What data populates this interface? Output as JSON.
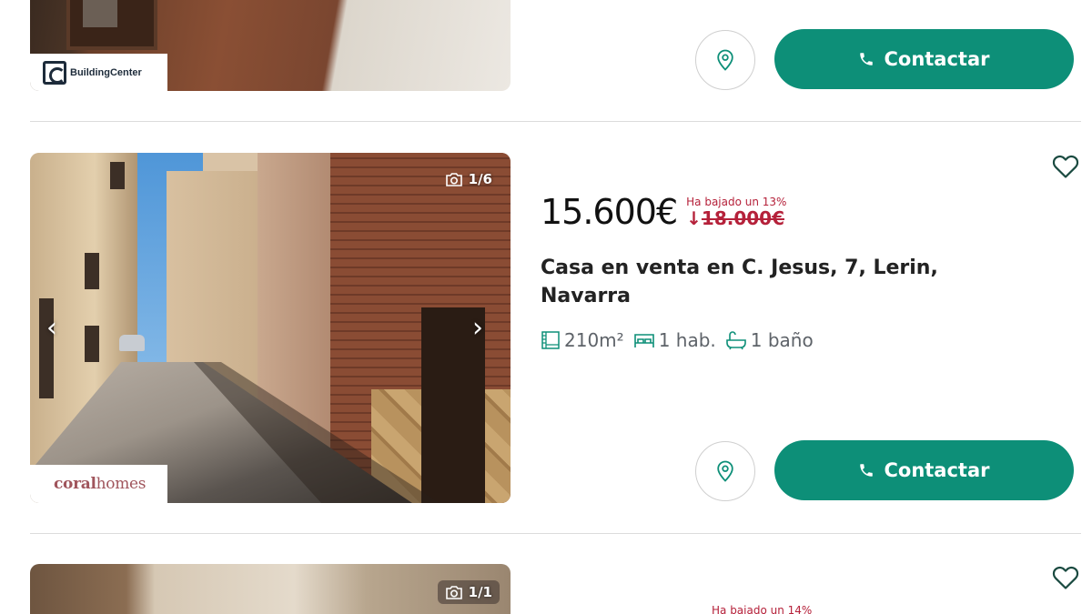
{
  "colors": {
    "accent": "#0d8f78",
    "price_drop": "#b5213a",
    "divider": "#dcdcdc"
  },
  "listings": [
    {
      "agency": {
        "logo_text": "BuildingCenter"
      },
      "actions": {
        "contact_label": "Contactar",
        "map_icon": "map-pin-icon",
        "phone_icon": "phone-icon"
      }
    },
    {
      "photo_count": "1/6",
      "agency": {
        "logo_text_a": "coral",
        "logo_text_b": "homes"
      },
      "price": "15.600€",
      "price_drop": {
        "label": "Ha bajado un 13%",
        "old_price": "18.000€",
        "arrow": "↓"
      },
      "title": "Casa en venta en C. Jesus, 7, Lerin, Navarra",
      "features": {
        "area": "210m²",
        "rooms": "1 hab.",
        "baths": "1 baño"
      },
      "actions": {
        "contact_label": "Contactar",
        "map_icon": "map-pin-icon",
        "phone_icon": "phone-icon"
      }
    },
    {
      "photo_count": "1/1",
      "price_drop": {
        "label": "Ha bajado un 14%"
      }
    }
  ]
}
